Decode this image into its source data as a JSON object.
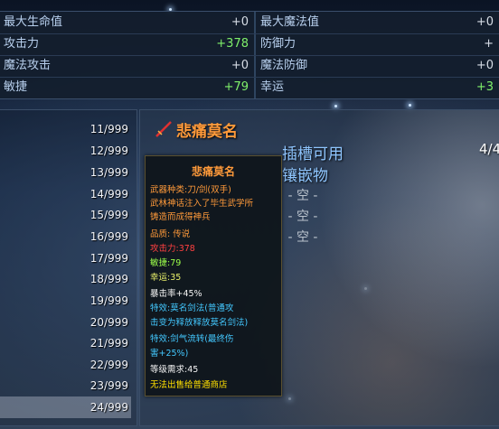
{
  "stats": {
    "left": [
      {
        "label": "最大生命值",
        "value": "+0"
      },
      {
        "label": "攻击力",
        "value": "+378"
      },
      {
        "label": "魔法攻击",
        "value": "+0"
      },
      {
        "label": "敏捷",
        "value": "+79"
      }
    ],
    "right": [
      {
        "label": "最大魔法值",
        "value": "+0"
      },
      {
        "label": "防御力",
        "value": "+"
      },
      {
        "label": "魔法防御",
        "value": "+0"
      },
      {
        "label": "幸运",
        "value": "+3"
      }
    ]
  },
  "inventory": {
    "quantities": [
      "11/999",
      "12/999",
      "13/999",
      "14/999",
      "15/999",
      "16/999",
      "17/999",
      "18/999",
      "19/999",
      "20/999",
      "21/999",
      "22/999",
      "23/999",
      "24/999"
    ]
  },
  "item": {
    "name": "悲痛莫名",
    "slots_line1": "插槽可用",
    "slots_line2": "镶嵌物",
    "page": "4/4",
    "empty_slot": "- 空 -"
  },
  "tooltip": {
    "title": "悲痛莫名",
    "weapon_type": "武器种类:刀/剑(双手)",
    "desc1": "武林神话注入了毕生武学所",
    "desc2": "铸造而成得神兵",
    "quality": "品质: 传说",
    "attack": "攻击力:378",
    "agility": "敏捷:79",
    "luck": "幸运:35",
    "crit": "暴击率+45%",
    "effect1a": "特效:莫名剑法(普通攻",
    "effect1b": "击变为释放释放莫名剑法)",
    "effect2a": "特效:剑气流转(最终伤",
    "effect2b": "害+25%)",
    "level": "等级需求:45",
    "sell": "无法出售给普通商店"
  }
}
